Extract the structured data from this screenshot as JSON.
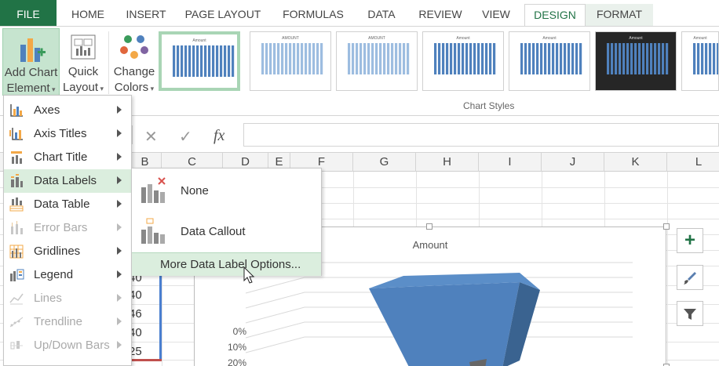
{
  "tabs": {
    "file": "FILE",
    "home": "HOME",
    "insert": "INSERT",
    "page_layout": "PAGE LAYOUT",
    "formulas": "FORMULAS",
    "data": "DATA",
    "review": "REVIEW",
    "view": "VIEW",
    "design": "DESIGN",
    "format": "FORMAT"
  },
  "ribbon": {
    "add_chart_element": {
      "line1": "Add Chart",
      "line2": "Element"
    },
    "quick_layout": {
      "line1": "Quick",
      "line2": "Layout"
    },
    "change_colors": {
      "line1": "Change",
      "line2": "Colors"
    },
    "chart_styles_label": "Chart Styles",
    "style_thumb_titles": [
      "Amount",
      "AMOUNT",
      "AMOUNT",
      "Amount",
      "Amount",
      "Amount",
      "Amount"
    ]
  },
  "formula_bar": {
    "cancel_symbol": "✕",
    "enter_symbol": "✓",
    "fx_symbol": "fx",
    "value": ""
  },
  "sheet": {
    "columns": [
      "B",
      "C",
      "D",
      "E",
      "F",
      "G",
      "H",
      "I",
      "J",
      "K",
      "L"
    ],
    "visible_cells": [
      "40",
      "40",
      "46",
      "40",
      "25"
    ]
  },
  "chart": {
    "title": "Amount",
    "axis_ticks": [
      "0%",
      "10%",
      "20%"
    ],
    "colors": {
      "face": "#4f81bd",
      "side": "#3a6390",
      "top": "#5b8ec8"
    }
  },
  "menu": {
    "items": [
      {
        "label": "Axes",
        "icon": "axes-icon",
        "disabled": false
      },
      {
        "label": "Axis Titles",
        "icon": "axis-titles-icon",
        "disabled": false
      },
      {
        "label": "Chart Title",
        "icon": "chart-title-icon",
        "disabled": false
      },
      {
        "label": "Data Labels",
        "icon": "data-labels-icon",
        "disabled": false
      },
      {
        "label": "Data Table",
        "icon": "data-table-icon",
        "disabled": false
      },
      {
        "label": "Error Bars",
        "icon": "error-bars-icon",
        "disabled": true
      },
      {
        "label": "Gridlines",
        "icon": "gridlines-icon",
        "disabled": false
      },
      {
        "label": "Legend",
        "icon": "legend-icon",
        "disabled": false
      },
      {
        "label": "Lines",
        "icon": "lines-icon",
        "disabled": true
      },
      {
        "label": "Trendline",
        "icon": "trendline-icon",
        "disabled": true
      },
      {
        "label": "Up/Down Bars",
        "icon": "up-down-bars-icon",
        "disabled": true
      }
    ]
  },
  "submenu": {
    "none": "None",
    "data_callout": "Data Callout",
    "more_options": "More Data Label Options..."
  },
  "side_buttons": {
    "chart_elements_symbol": "+"
  },
  "colors": {
    "accent": "#217346",
    "selection": "#4a7fd0"
  }
}
